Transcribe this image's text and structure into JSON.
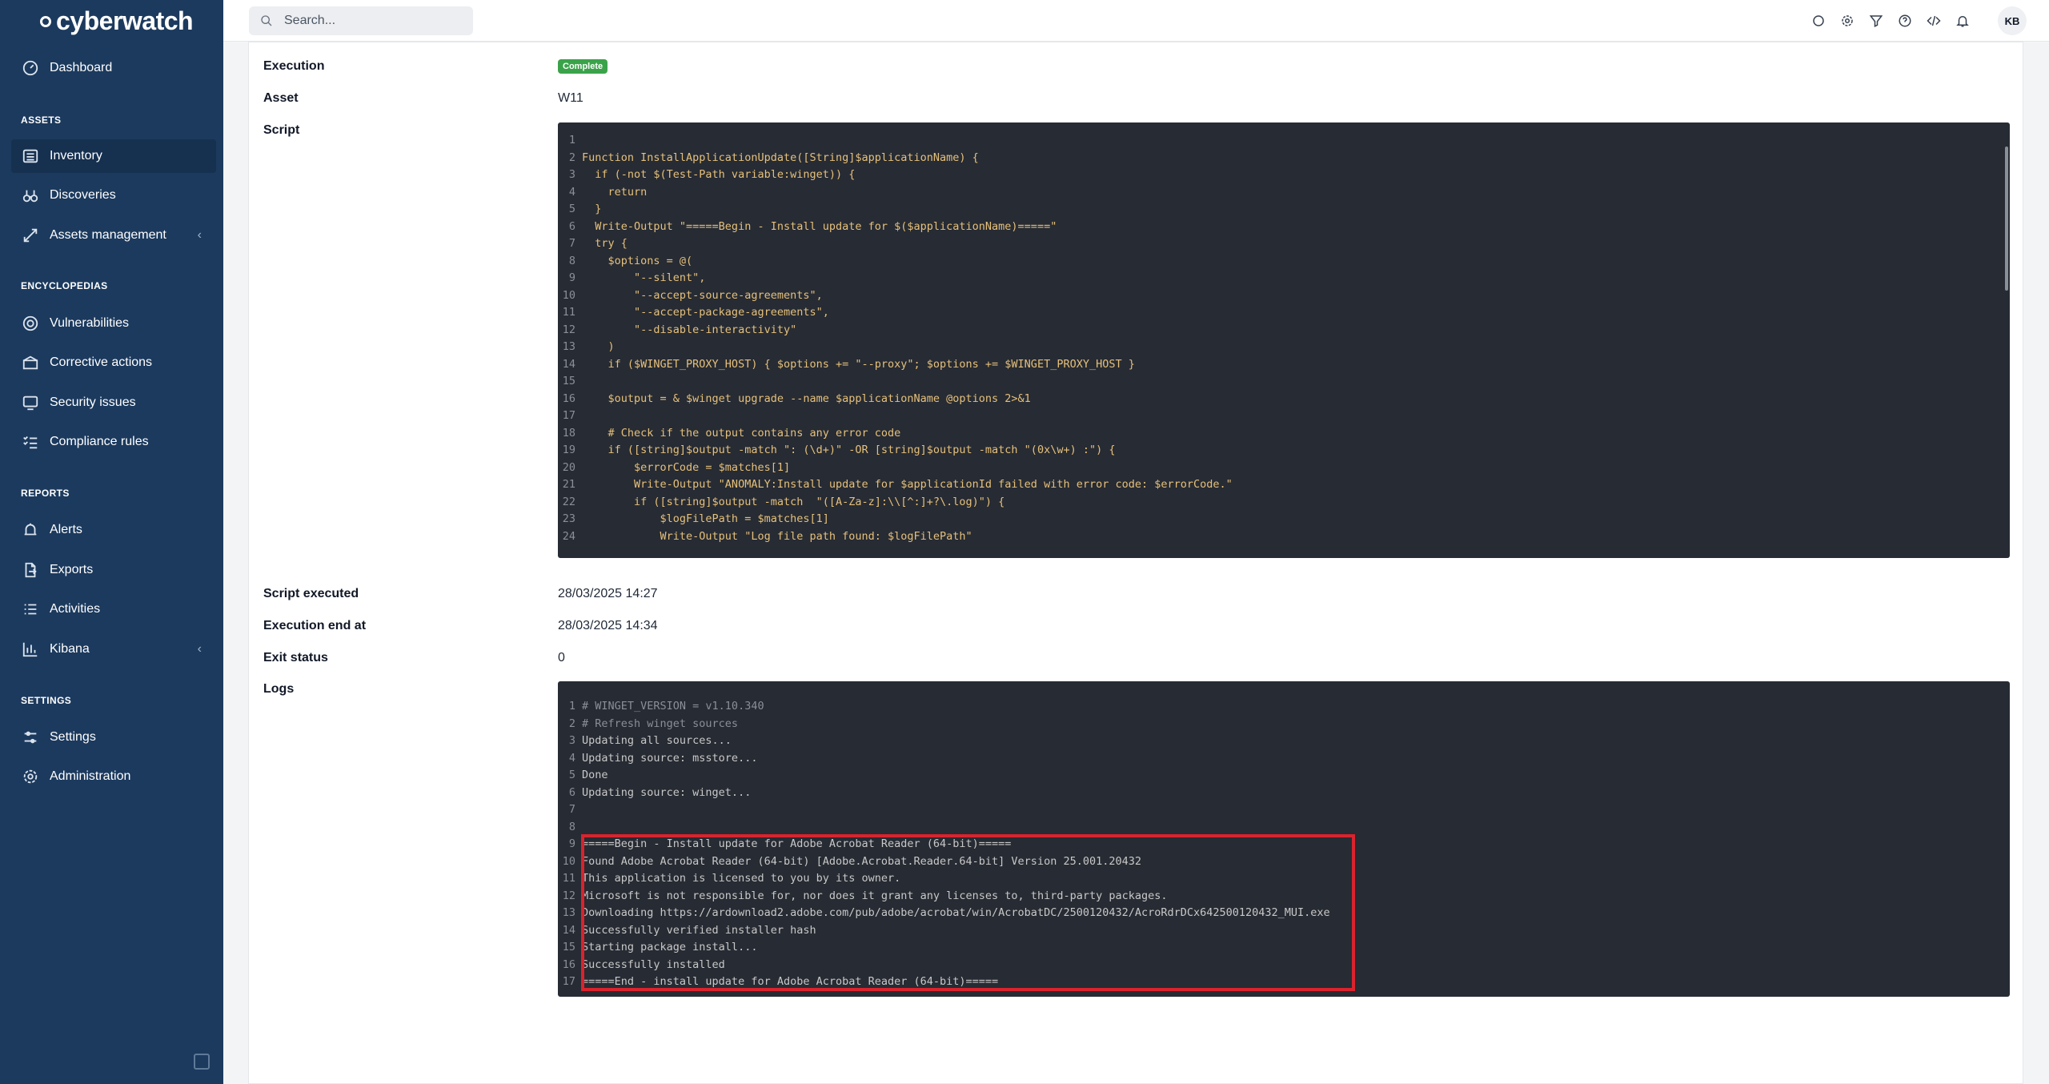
{
  "app": {
    "logo": "cyberwatch"
  },
  "search": {
    "placeholder": "Search..."
  },
  "topbar": {
    "avatar": "KB",
    "icons": [
      "circle-icon",
      "gear-icon",
      "filter-icon",
      "help-icon",
      "code-icon",
      "bell-icon"
    ]
  },
  "sidebar": {
    "dashboard": "Dashboard",
    "assets_title": "ASSETS",
    "inventory": "Inventory",
    "discoveries": "Discoveries",
    "assets_management": "Assets management",
    "encyclopedias_title": "ENCYCLOPEDIAS",
    "vulnerabilities": "Vulnerabilities",
    "corrective_actions": "Corrective actions",
    "security_issues": "Security issues",
    "compliance_rules": "Compliance rules",
    "reports_title": "REPORTS",
    "alerts": "Alerts",
    "exports": "Exports",
    "activities": "Activities",
    "kibana": "Kibana",
    "settings_title": "SETTINGS",
    "settings": "Settings",
    "administration": "Administration"
  },
  "details": {
    "execution_label": "Execution",
    "execution_status": "Complete",
    "asset_label": "Asset",
    "asset_value": "W11",
    "script_label": "Script",
    "script_executed_label": "Script executed",
    "script_executed_value": "28/03/2025 14:27",
    "execution_end_label": "Execution end at",
    "execution_end_value": "28/03/2025 14:34",
    "exit_status_label": "Exit status",
    "exit_status_value": "0",
    "logs_label": "Logs"
  },
  "script_lines": [
    "",
    "Function InstallApplicationUpdate([String]$applicationName) {",
    "  if (-not $(Test-Path variable:winget)) {",
    "    return",
    "  }",
    "  Write-Output \"=====Begin - Install update for $($applicationName)=====\"",
    "  try {",
    "    $options = @(",
    "        \"--silent\",",
    "        \"--accept-source-agreements\",",
    "        \"--accept-package-agreements\",",
    "        \"--disable-interactivity\"",
    "    )",
    "    if ($WINGET_PROXY_HOST) { $options += \"--proxy\"; $options += $WINGET_PROXY_HOST }",
    "",
    "    $output = & $winget upgrade --name $applicationName @options 2>&1",
    "",
    "    # Check if the output contains any error code",
    "    if ([string]$output -match \": (\\d+)\" -OR [string]$output -match \"(0x\\w+) :\") {",
    "        $errorCode = $matches[1]",
    "        Write-Output \"ANOMALY:Install update for $applicationId failed with error code: $errorCode.\"",
    "        if ([string]$output -match  \"([A-Za-z]:\\\\[^:]+?\\.log)\") {",
    "            $logFilePath = $matches[1]",
    "            Write-Output \"Log file path found: $logFilePath\""
  ],
  "log_lines": [
    "# WINGET_VERSION = v1.10.340",
    "# Refresh winget sources",
    "Updating all sources...",
    "Updating source: msstore...",
    "Done",
    "Updating source: winget...",
    "",
    "",
    "=====Begin - Install update for Adobe Acrobat Reader (64-bit)=====",
    "Found Adobe Acrobat Reader (64-bit) [Adobe.Acrobat.Reader.64-bit] Version 25.001.20432",
    "This application is licensed to you by its owner.",
    "Microsoft is not responsible for, nor does it grant any licenses to, third-party packages.",
    "Downloading https://ardownload2.adobe.com/pub/adobe/acrobat/win/AcrobatDC/2500120432/AcroRdrDCx642500120432_MUI.exe",
    "Successfully verified installer hash",
    "Starting package install...",
    "Successfully installed",
    "=====End - install update for Adobe Acrobat Reader (64-bit)====="
  ],
  "colors": {
    "sidebar": "#1c3a5e",
    "badge": "#3aa34a",
    "highlight": "#d9232d",
    "code_bg": "#272b33"
  }
}
